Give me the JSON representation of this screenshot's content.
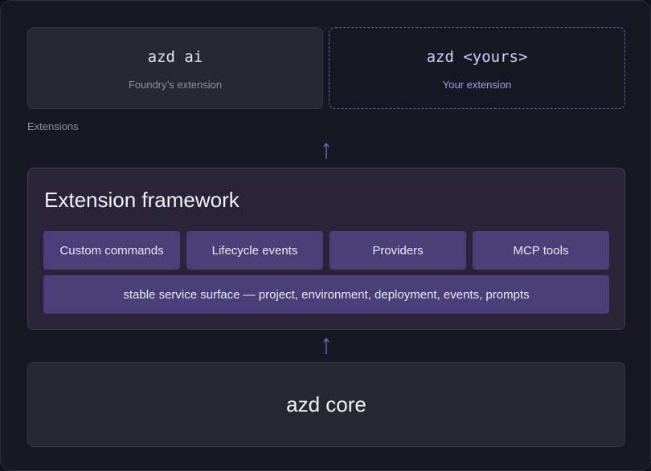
{
  "extensions": {
    "label": "Extensions",
    "cards": [
      {
        "command": "azd ai",
        "caption": "Foundry’s extension"
      },
      {
        "command": "azd <yours>",
        "caption": "Your extension"
      }
    ]
  },
  "framework": {
    "title": "Extension framework",
    "features": [
      "Custom commands",
      "Lifecycle events",
      "Providers",
      "MCP tools"
    ],
    "surface": "stable service surface — project, environment, deployment, events, prompts"
  },
  "core": {
    "title": "azd core"
  },
  "colors": {
    "background": "#161922",
    "card": "#262932",
    "accent": "#6e63b8",
    "framework_bg": "#2a2438",
    "chip": "#4a3f78",
    "arrow": "#7f72d6"
  },
  "icons": [
    "arrow-up-icon",
    "arrow-up-icon"
  ]
}
